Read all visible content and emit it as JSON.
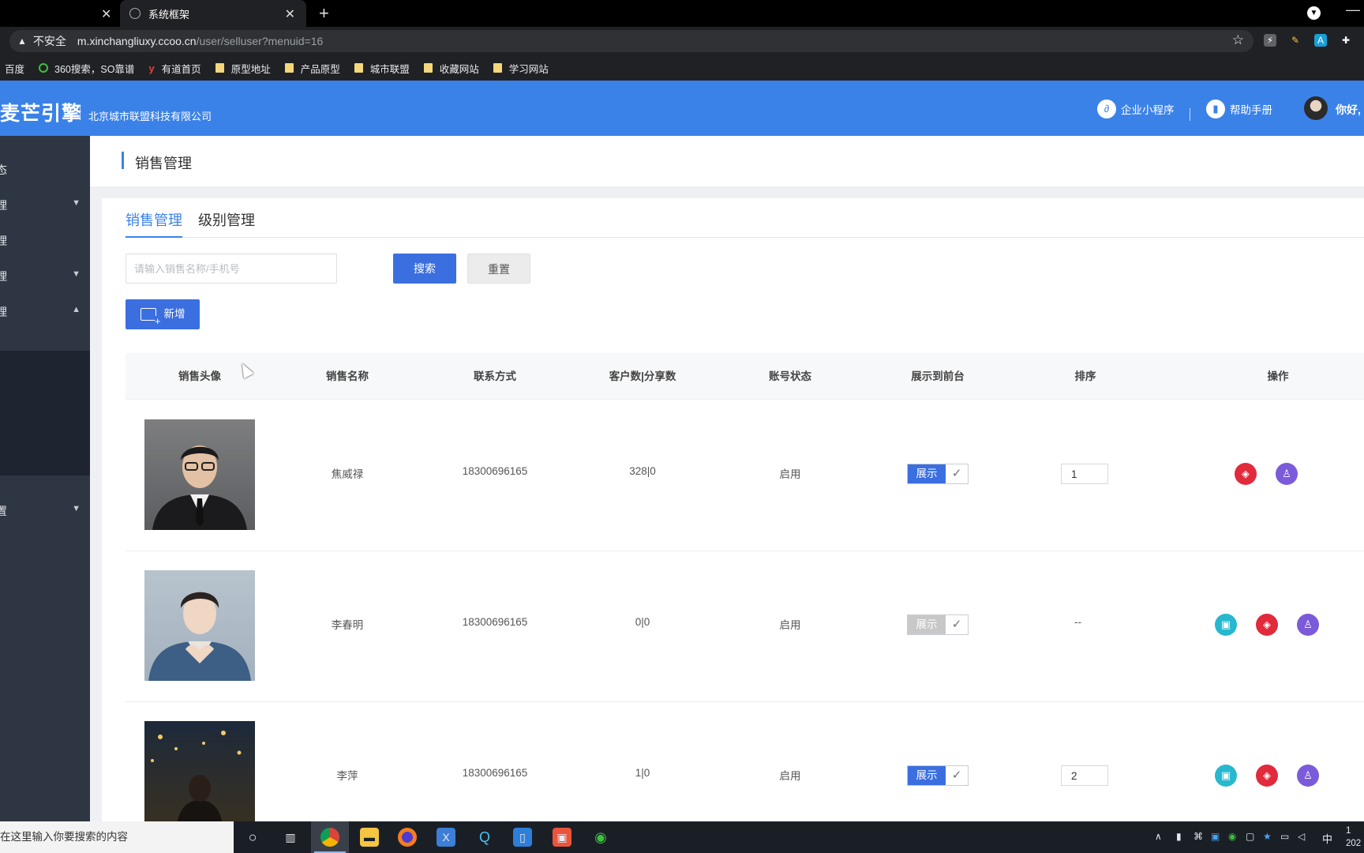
{
  "browser": {
    "tabs": [
      {
        "label": ""
      },
      {
        "label": "系统框架"
      }
    ],
    "address": {
      "security": "不安全",
      "host": "m.xinchangliuxy.ccoo.cn",
      "path": "/user/selluser?menuid=16"
    },
    "bookmarks": [
      {
        "label": "百度",
        "icon": "none"
      },
      {
        "label": "360搜索，SO靠谱",
        "icon": "360-icon"
      },
      {
        "label": "有道首页",
        "icon": "youdao-icon"
      },
      {
        "label": "原型地址",
        "icon": "folder-icon"
      },
      {
        "label": "产品原型",
        "icon": "folder-icon"
      },
      {
        "label": "城市联盟",
        "icon": "folder-icon"
      },
      {
        "label": "收藏网站",
        "icon": "folder-icon"
      },
      {
        "label": "学习网站",
        "icon": "folder-icon"
      }
    ]
  },
  "header": {
    "logo": "麦芒引擎",
    "company": "北京城市联盟科技有限公司",
    "mini_program": "企业小程序",
    "help": "帮助手册",
    "greeting": "你好,",
    "accent_color": "#3b82e8"
  },
  "sidebar": {
    "items": [
      {
        "label": "态",
        "arrow": ""
      },
      {
        "label": "理",
        "arrow": "▼"
      },
      {
        "label": "理",
        "arrow": ""
      },
      {
        "label": "理",
        "arrow": "▼"
      },
      {
        "label": "理",
        "arrow": "▲"
      },
      {
        "label": "置",
        "arrow": "▼"
      }
    ]
  },
  "page": {
    "title": "销售管理",
    "tabs": [
      {
        "label": "销售管理",
        "active": true
      },
      {
        "label": "级别管理",
        "active": false
      }
    ],
    "search": {
      "placeholder": "请输入销售名称/手机号",
      "value": "",
      "search_label": "搜索",
      "reset_label": "重置"
    },
    "add_label": "新增"
  },
  "table": {
    "columns": [
      "销售头像",
      "销售名称",
      "联系方式",
      "客户数|分享数",
      "账号状态",
      "展示到前台",
      "排序",
      "操作"
    ],
    "rows": [
      {
        "name": "焦威禄",
        "phone": "18300696165",
        "counts": "328|0",
        "status": "启用",
        "display_label": "展示",
        "display_on": true,
        "sort": "1",
        "sort_editable": true,
        "actions": [
          "layers-icon",
          "user-icon"
        ]
      },
      {
        "name": "李春明",
        "phone": "18300696165",
        "counts": "0|0",
        "status": "启用",
        "display_label": "展示",
        "display_on": false,
        "sort": "--",
        "sort_editable": false,
        "actions": [
          "image-icon",
          "layers-icon",
          "user-icon"
        ]
      },
      {
        "name": "李萍",
        "phone": "18300696165",
        "counts": "1|0",
        "status": "启用",
        "display_label": "展示",
        "display_on": true,
        "sort": "2",
        "sort_editable": true,
        "actions": [
          "image-icon",
          "layers-icon",
          "user-icon"
        ]
      }
    ]
  },
  "taskbar": {
    "search_text": "在这里输入你要搜索的内容",
    "ime": "中",
    "clock_line1": "1",
    "clock_line2": "202"
  }
}
